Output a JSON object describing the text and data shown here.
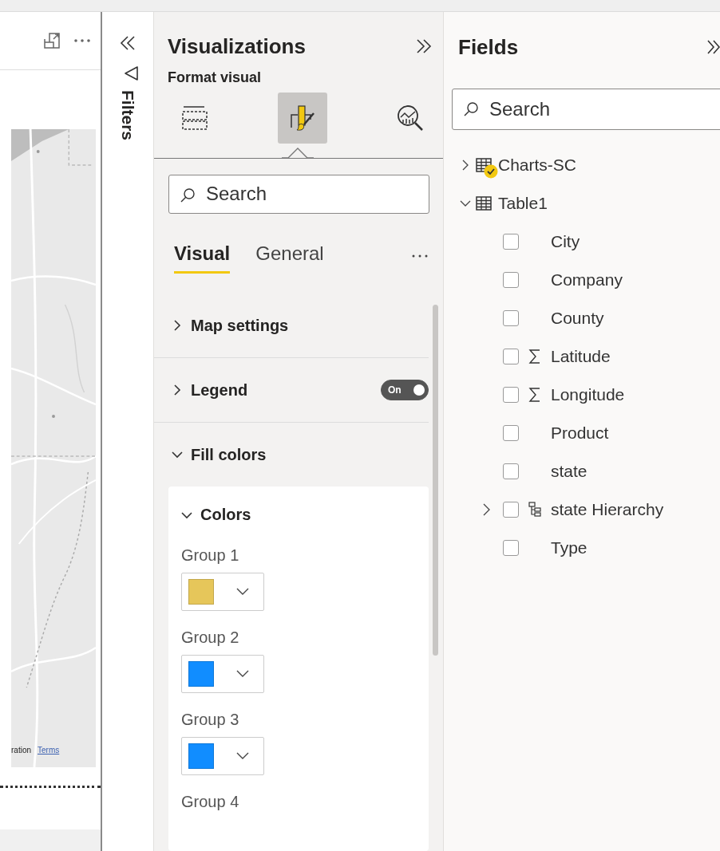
{
  "report_canvas": {
    "kind": "picture",
    "attribution": "ration",
    "terms_link": "Terms"
  },
  "filters_pane": {
    "title": "Filters"
  },
  "visualizations_pane": {
    "title": "Visualizations",
    "subtitle": "Format visual",
    "modes": [
      {
        "kind": "build",
        "selected": false
      },
      {
        "kind": "format",
        "selected": true
      },
      {
        "kind": "analytics",
        "selected": false
      }
    ],
    "search": {
      "placeholder": "Search"
    },
    "tabs": [
      {
        "label": "Visual",
        "selected": true
      },
      {
        "label": "General",
        "selected": false
      }
    ],
    "sections": [
      {
        "title": "Map settings",
        "expanded": false
      },
      {
        "title": "Legend",
        "expanded": false,
        "toggle": {
          "on": true,
          "label": "On"
        }
      },
      {
        "title": "Fill colors",
        "expanded": true,
        "card": {
          "title": "Colors",
          "expanded": true,
          "groups": [
            {
              "label": "Group 1",
              "color": "#e6c65a"
            },
            {
              "label": "Group 2",
              "color": "#118dff"
            },
            {
              "label": "Group 3",
              "color": "#118dff"
            },
            {
              "label": "Group 4"
            }
          ]
        }
      }
    ]
  },
  "fields_pane": {
    "title": "Fields",
    "search": {
      "placeholder": "Search"
    },
    "tables": [
      {
        "name": "Charts-SC",
        "expanded": false,
        "in_use": true
      },
      {
        "name": "Table1",
        "expanded": true,
        "in_use": false,
        "children": [
          {
            "name": "City",
            "kind": "text",
            "checked": false
          },
          {
            "name": "Company",
            "kind": "text",
            "checked": false
          },
          {
            "name": "County",
            "kind": "text",
            "checked": false
          },
          {
            "name": "Latitude",
            "kind": "sum",
            "checked": false
          },
          {
            "name": "Longitude",
            "kind": "sum",
            "checked": false
          },
          {
            "name": "Product",
            "kind": "text",
            "checked": false
          },
          {
            "name": "state",
            "kind": "text",
            "checked": false
          },
          {
            "name": "state Hierarchy",
            "kind": "hierarchy",
            "expanded": false,
            "checked": false
          },
          {
            "name": "Type",
            "kind": "text",
            "checked": false
          }
        ]
      }
    ]
  }
}
